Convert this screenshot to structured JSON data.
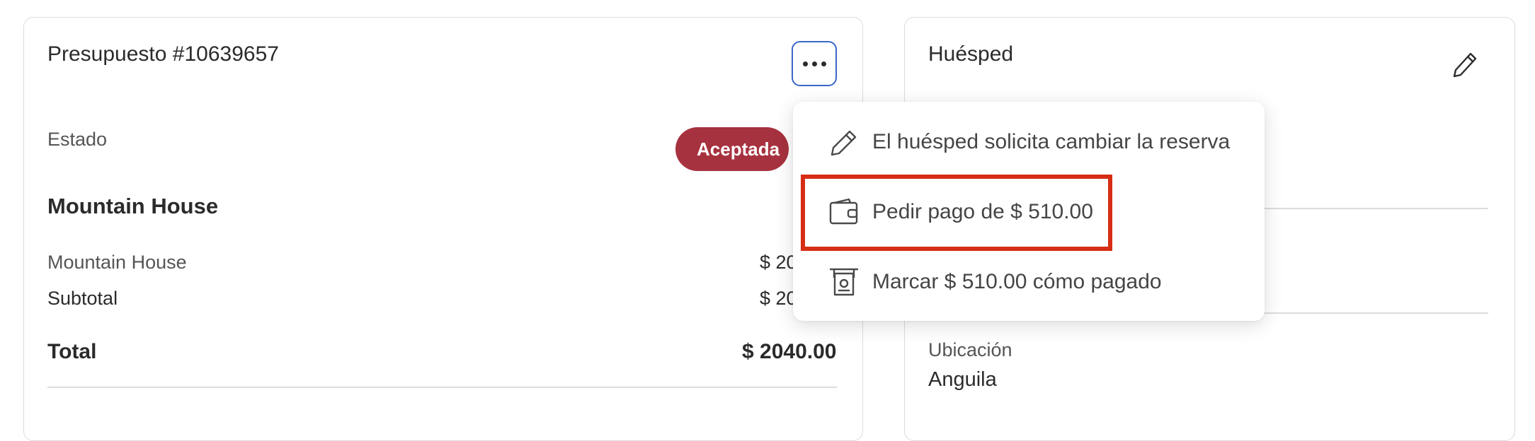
{
  "quote": {
    "title": "Presupuesto #10639657",
    "status_label": "Estado",
    "status_badge": "Aceptada",
    "property_name": "Mountain House",
    "line_item_label": "Mountain House",
    "line_item_value": "$ 20",
    "subtotal_label": "Subtotal",
    "subtotal_value": "$ 20",
    "total_label": "Total",
    "total_value": "$ 2040.00"
  },
  "guest": {
    "title": "Huésped",
    "location_label": "Ubicación",
    "location_value": "Anguila"
  },
  "menu": {
    "items": [
      {
        "label": "El huésped solicita cambiar la reserva",
        "icon": "pencil-icon"
      },
      {
        "label": "Pedir pago de $ 510.00",
        "icon": "wallet-icon"
      },
      {
        "label": "Marcar $ 510.00 cómo pagado",
        "icon": "cash-icon"
      }
    ]
  },
  "colors": {
    "badge": "#a7323f",
    "focus_ring": "#3a66c9",
    "highlight": "#d62d14"
  }
}
